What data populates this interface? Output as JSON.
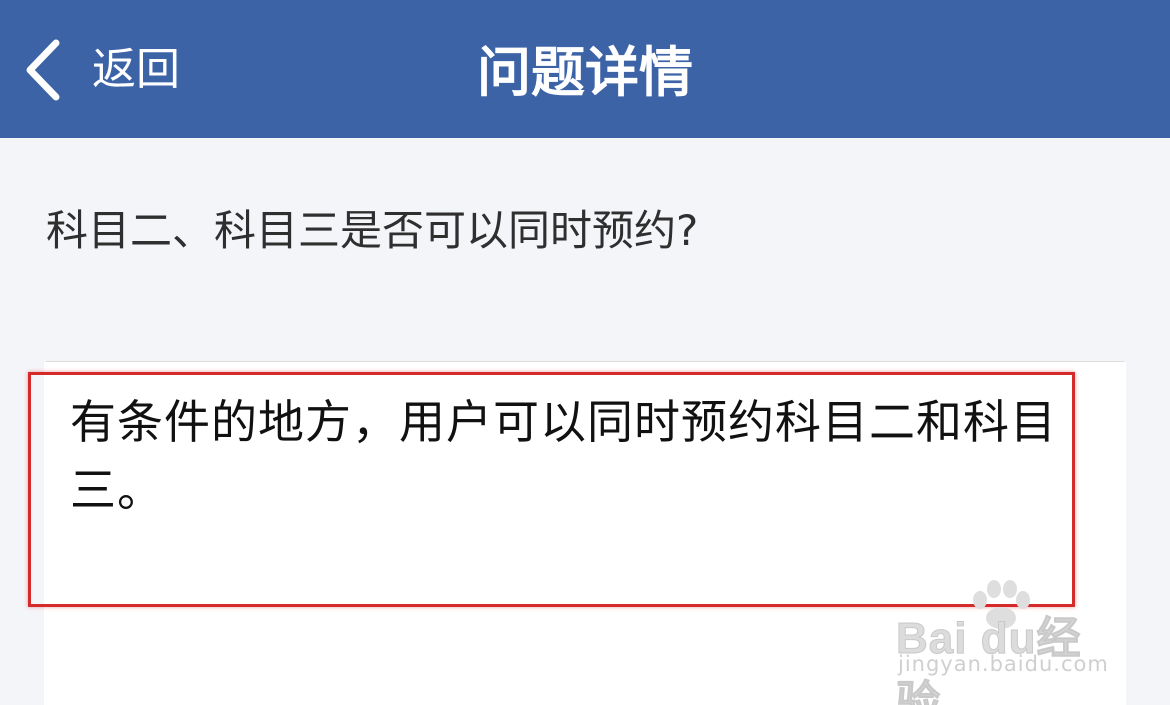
{
  "navbar": {
    "back_label": "返回",
    "title": "问题详情",
    "icons": {
      "back": "chevron-left-icon"
    },
    "background_color": "#3b63a6"
  },
  "question": {
    "text": "科目二、科目三是否可以同时预约?"
  },
  "answer": {
    "text": "有条件的地方，用户可以同时预约科目二和科目三。",
    "highlight_color": "#d42a2a"
  },
  "watermark": {
    "logo_text": "Bai du经验",
    "domain": "jingyan.baidu.com"
  }
}
